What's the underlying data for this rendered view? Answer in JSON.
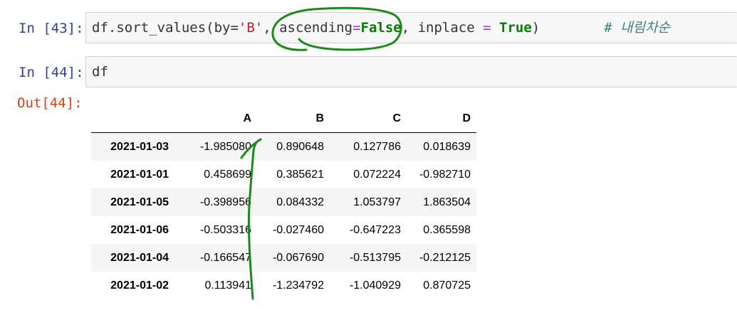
{
  "cells": [
    {
      "prompt": "In [43]:",
      "code": {
        "prefix": "df.sort_values(by=",
        "str": "'B'",
        "mid1": ", ascending",
        "eq1": "=",
        "kw1": "False",
        "mid2": ", inplace ",
        "eq2": "=",
        "kw2": " True",
        "suffix": ")",
        "comment": "# 내림차순"
      }
    },
    {
      "prompt": "In [44]:",
      "code": "df"
    }
  ],
  "output": {
    "prompt": "Out[44]:",
    "columns": [
      "A",
      "B",
      "C",
      "D"
    ],
    "rows": [
      {
        "index": "2021-01-03",
        "values": [
          "-1.985080",
          "0.890648",
          "0.127786",
          "0.018639"
        ]
      },
      {
        "index": "2021-01-01",
        "values": [
          "0.458699",
          "0.385621",
          "0.072224",
          "-0.982710"
        ]
      },
      {
        "index": "2021-01-05",
        "values": [
          "-0.398956",
          "0.084332",
          "1.053797",
          "1.863504"
        ]
      },
      {
        "index": "2021-01-06",
        "values": [
          "-0.503316",
          "-0.027460",
          "-0.647223",
          "0.365598"
        ]
      },
      {
        "index": "2021-01-04",
        "values": [
          "-0.166547",
          "-0.067690",
          "-0.513795",
          "-0.212125"
        ]
      },
      {
        "index": "2021-01-02",
        "values": [
          "0.113941",
          "-1.234792",
          "-1.040929",
          "0.870725"
        ]
      }
    ]
  },
  "annotation_color": "#1a8a1a"
}
